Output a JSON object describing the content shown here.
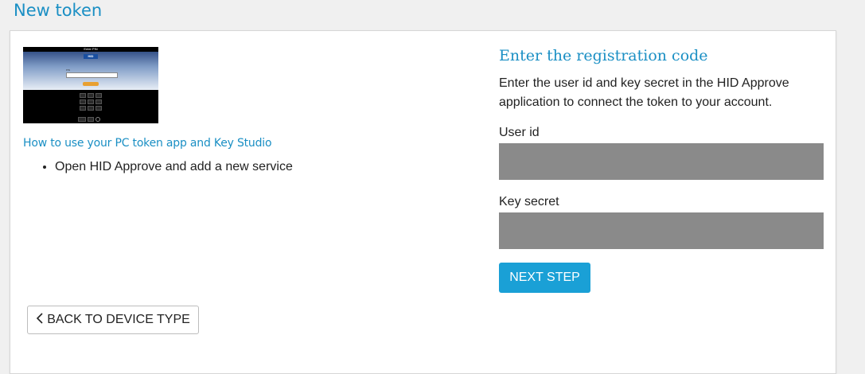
{
  "page": {
    "title": "New token"
  },
  "left": {
    "image": {
      "heading": "Enter PIN",
      "brand": "HID",
      "pin_label": "PIN"
    },
    "howto_link": "How to use your PC token app and Key Studio",
    "steps": [
      "Open HID Approve and add a new service"
    ],
    "back_label": "BACK TO DEVICE TYPE"
  },
  "right": {
    "title": "Enter the registration code",
    "description": "Enter the user id and key secret in the HID Approve application to connect the token to your account.",
    "user_id_label": "User id",
    "user_id_value": "",
    "key_secret_label": "Key secret",
    "key_secret_value": "",
    "next_label": "NEXT STEP"
  },
  "colors": {
    "accent": "#1a8fc4",
    "button": "#1aa0d6",
    "field_bg": "#8a8a8a"
  },
  "icons": {
    "back": "chevron-left-icon"
  }
}
